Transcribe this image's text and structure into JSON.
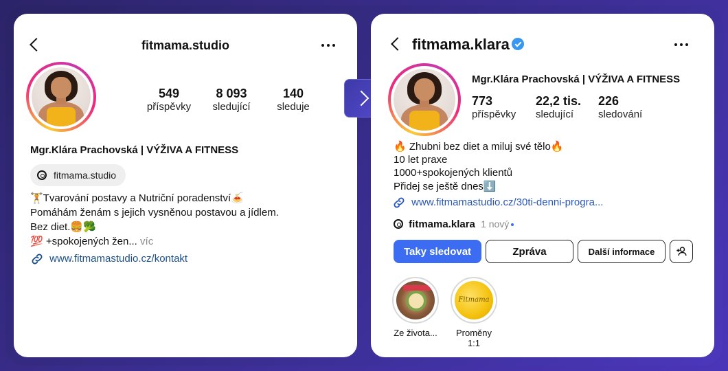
{
  "left": {
    "username": "fitmama.studio",
    "stats": [
      {
        "num": "549",
        "label": "příspěvky"
      },
      {
        "num": "8 093",
        "label": "sledující"
      },
      {
        "num": "140",
        "label": "sleduje"
      }
    ],
    "display_name": "Mgr.Klára Prachovská | VÝŽIVA A FITNESS",
    "threads_handle": "fitmama.studio",
    "bio_lines": [
      "🏋️Tvarování postavy a Nutriční poradenství🍝",
      "Pomáhám ženám s jejich vysněnou postavou a jídlem.",
      "Bez diet.🍔🥦"
    ],
    "bio_last_line": "💯 +spokojených žen...",
    "more_label": "víc",
    "website": "www.fitmamastudio.cz/kontakt"
  },
  "right": {
    "username": "fitmama.klara",
    "display_name": "Mgr.Klára Prachovská | VÝŽIVA A FITNESS",
    "stats": [
      {
        "num": "773",
        "label": "příspěvky"
      },
      {
        "num": "22,2 tis.",
        "label": "sledující"
      },
      {
        "num": "226",
        "label": "sledování"
      }
    ],
    "bio_lines": [
      "🔥 Zhubni bez diet a miluj své tělo🔥",
      "10 let praxe",
      "1000+spokojených klientů",
      "Přidej se ještě dnes⬇️"
    ],
    "website": "www.fitmamastudio.cz/30ti-denni-progra...",
    "threads_handle": "fitmama.klara",
    "threads_new": "1 nový",
    "buttons": {
      "follow": "Taky sledovat",
      "message": "Zpráva",
      "more_info": "Další informace"
    },
    "highlights": [
      {
        "label": "Ze života..."
      },
      {
        "label": "Proměny 1:1"
      }
    ],
    "highlight_logo_text": "Fitmama"
  },
  "colors": {
    "accent_blue": "#3b6cf2",
    "verified_blue": "#3897f0",
    "ring_yellow": "#f9ce34",
    "ring_pink": "#ee2a7b",
    "background_purple": "#3b2f95"
  }
}
